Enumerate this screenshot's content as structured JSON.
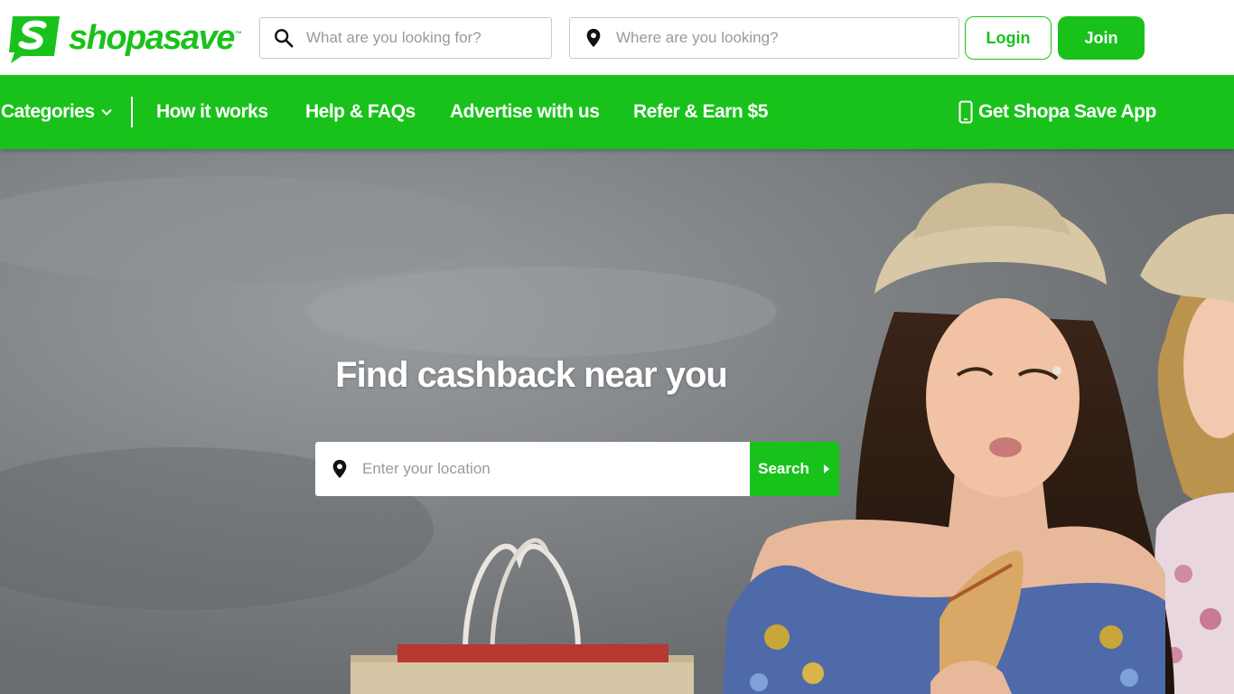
{
  "brand": {
    "name": "shopasave",
    "trademark": "™",
    "accent_color": "#19c21b"
  },
  "header": {
    "what_search": {
      "placeholder": "What are you looking for?",
      "icon": "search-icon"
    },
    "where_search": {
      "placeholder": "Where are you looking?",
      "icon": "location-pin-icon"
    },
    "login_label": "Login",
    "join_label": "Join"
  },
  "nav": {
    "categories_label": "Categories",
    "items": [
      {
        "label": "How it works"
      },
      {
        "label": "Help & FAQs"
      },
      {
        "label": "Advertise with us"
      },
      {
        "label": "Refer & Earn $5"
      }
    ],
    "app_label": "Get Shopa Save App",
    "app_icon": "phone-icon"
  },
  "hero": {
    "title": "Find cashback near you",
    "location_placeholder": "Enter your location",
    "search_label": "Search"
  }
}
